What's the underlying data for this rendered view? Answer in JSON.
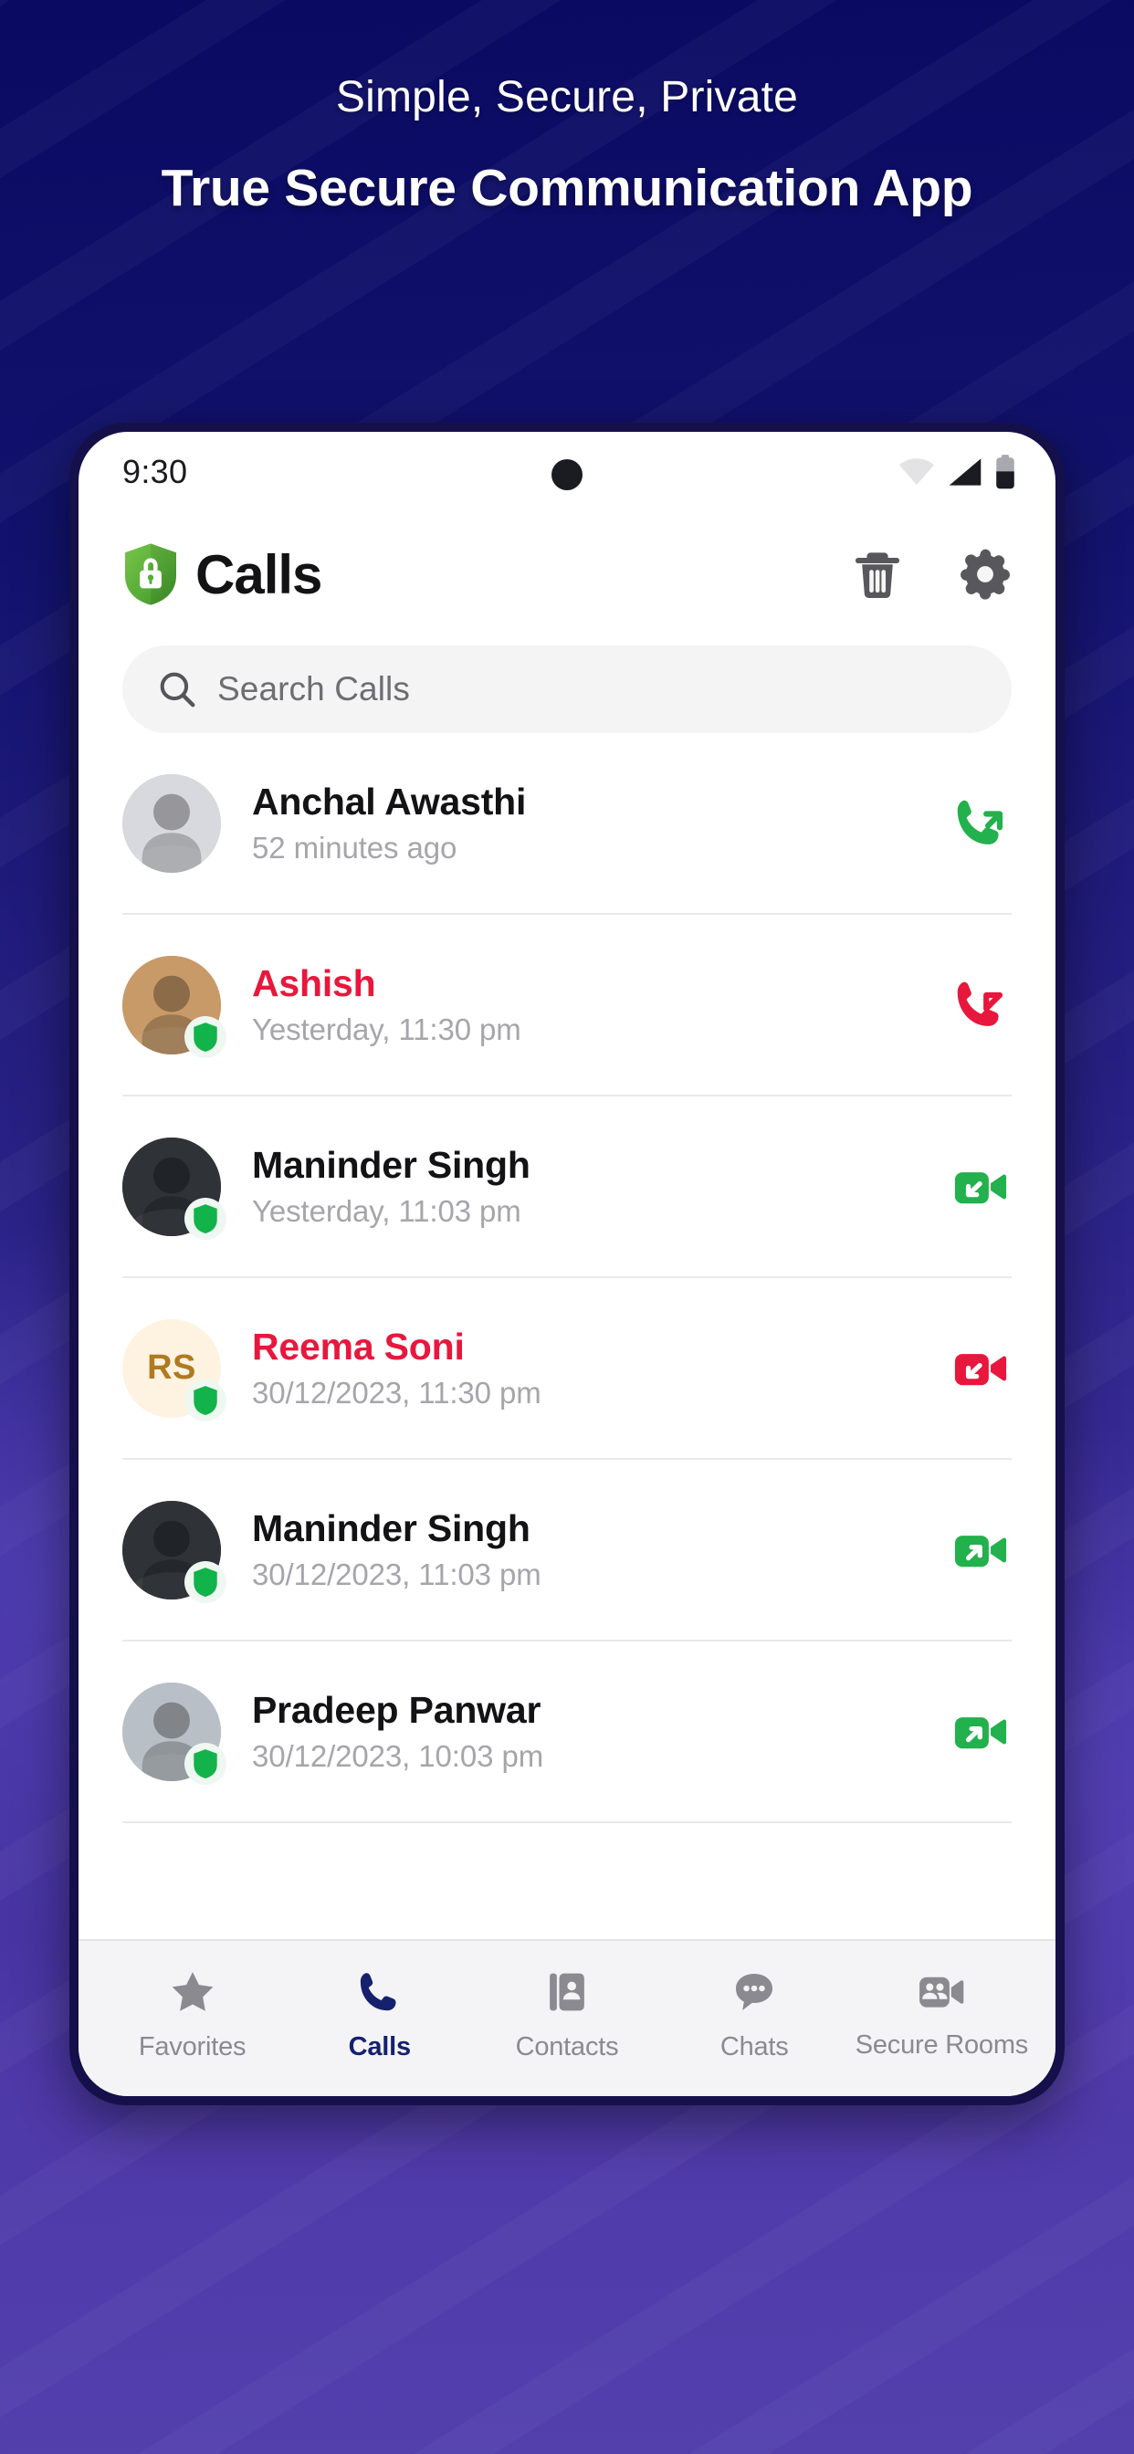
{
  "promo": {
    "tagline": "Simple, Secure, Private",
    "headline": "True Secure Communication App",
    "bg_top_color": "#0a0a62",
    "bg_bottom_color": "#5340ad"
  },
  "status_bar": {
    "time": "9:30",
    "wifi_icon": "wifi-icon",
    "signal_icon": "cellular-signal-icon",
    "battery_icon": "battery-icon"
  },
  "app_header": {
    "logo_icon": "shield-lock-icon",
    "title": "Calls",
    "delete_label": "Delete",
    "delete_icon": "trash-icon",
    "settings_label": "Settings",
    "settings_icon": "gear-icon"
  },
  "search": {
    "icon": "search-icon",
    "placeholder": "Search Calls",
    "value": ""
  },
  "colors": {
    "accent_green": "#22b14c",
    "accent_red": "#e8173d",
    "active_nav": "#16216e",
    "muted_text": "#a5a5ab"
  },
  "calls": [
    {
      "name": "Anchal Awasthi",
      "time": "52 minutes ago",
      "missed": false,
      "call_type": "outgoing-voice",
      "type_icon": "phone-outgoing-icon",
      "icon_color": "#22b14c",
      "avatar_kind": "photo",
      "avatar_initials": "",
      "avatar_bg": "#d8d9de",
      "avatar_fg": "#6b4a2a",
      "verified": false
    },
    {
      "name": "Ashish",
      "time": "Yesterday, 11:30 pm",
      "missed": true,
      "call_type": "missed-voice",
      "type_icon": "phone-incoming-icon",
      "icon_color": "#e8173d",
      "avatar_kind": "photo",
      "avatar_initials": "",
      "avatar_bg": "#c79a68",
      "avatar_fg": "#6b4a2a",
      "verified": true
    },
    {
      "name": "Maninder Singh",
      "time": "Yesterday, 11:03 pm",
      "missed": false,
      "call_type": "incoming-video",
      "type_icon": "video-incoming-icon",
      "icon_color": "#22b14c",
      "avatar_kind": "photo",
      "avatar_initials": "",
      "avatar_bg": "#2f3338",
      "avatar_fg": "#6b4a2a",
      "verified": true
    },
    {
      "name": "Reema Soni",
      "time": "30/12/2023, 11:30 pm",
      "missed": true,
      "call_type": "missed-video",
      "type_icon": "video-incoming-icon",
      "icon_color": "#e8173d",
      "avatar_kind": "initials",
      "avatar_initials": "RS",
      "avatar_bg": "#fdf3e0",
      "avatar_fg": "#b07a22",
      "verified": true
    },
    {
      "name": "Maninder Singh",
      "time": "30/12/2023, 11:03 pm",
      "missed": false,
      "call_type": "outgoing-video",
      "type_icon": "video-outgoing-icon",
      "icon_color": "#22b14c",
      "avatar_kind": "photo",
      "avatar_initials": "",
      "avatar_bg": "#2f3338",
      "avatar_fg": "#6b4a2a",
      "verified": true
    },
    {
      "name": "Pradeep Panwar",
      "time": "30/12/2023, 10:03 pm",
      "missed": false,
      "call_type": "outgoing-video",
      "type_icon": "video-outgoing-icon",
      "icon_color": "#22b14c",
      "avatar_kind": "photo",
      "avatar_initials": "",
      "avatar_bg": "#b9bfc6",
      "avatar_fg": "#6b4a2a",
      "verified": true
    }
  ],
  "bottom_nav": {
    "active": "Calls",
    "items": [
      {
        "label": "Favorites",
        "icon": "star-icon"
      },
      {
        "label": "Calls",
        "icon": "phone-icon"
      },
      {
        "label": "Contacts",
        "icon": "contact-book-icon"
      },
      {
        "label": "Chats",
        "icon": "chat-bubble-icon"
      },
      {
        "label": "Secure Rooms",
        "icon": "group-video-icon"
      }
    ]
  }
}
